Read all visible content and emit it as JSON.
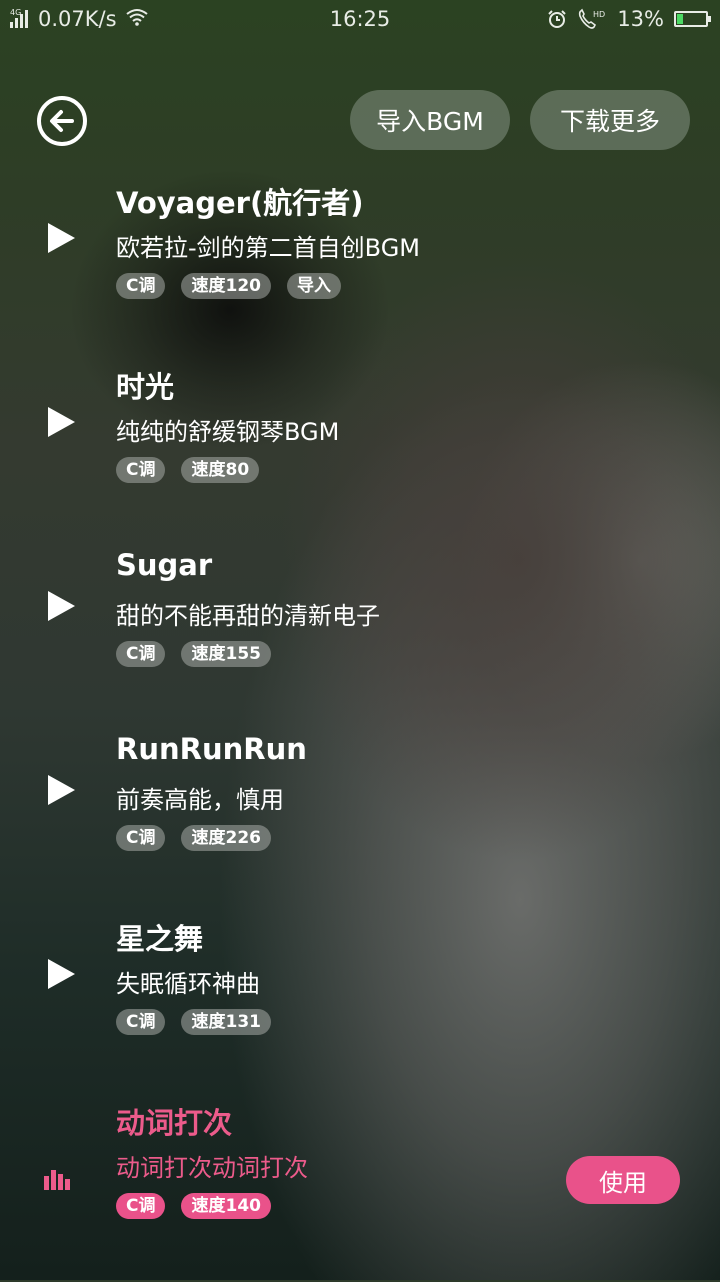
{
  "status_bar": {
    "network": "4G",
    "speed": "0.07K/s",
    "time": "16:25",
    "battery": "13%",
    "icons": [
      "signal-icon",
      "wifi-icon",
      "alarm-icon",
      "hd-call-icon",
      "battery-icon"
    ]
  },
  "header": {
    "back_icon": "back-arrow-circle-icon",
    "import_label": "导入BGM",
    "more_label": "下载更多"
  },
  "tracks": [
    {
      "title": "Voyager(航行者)",
      "desc": "欧若拉-剑的第二首自创BGM",
      "tags": [
        "C调",
        "速度120",
        "导入"
      ],
      "state": "paused"
    },
    {
      "title": "时光",
      "desc": "纯纯的舒缓钢琴BGM",
      "tags": [
        "C调",
        "速度80"
      ],
      "state": "paused"
    },
    {
      "title": "Sugar",
      "desc": "甜的不能再甜的清新电子",
      "tags": [
        "C调",
        "速度155"
      ],
      "state": "paused"
    },
    {
      "title": "RunRunRun",
      "desc": "前奏高能，慎用",
      "tags": [
        "C调",
        "速度226"
      ],
      "state": "paused"
    },
    {
      "title": "星之舞",
      "desc": "失眠循环神曲",
      "tags": [
        "C调",
        "速度131"
      ],
      "state": "paused"
    },
    {
      "title": "动词打次",
      "desc": "动词打次动词打次",
      "tags": [
        "C调",
        "速度140"
      ],
      "state": "playing",
      "action": "使用"
    }
  ],
  "colors": {
    "accent": "#e9528a",
    "tag_bg": "#9aa09a"
  }
}
